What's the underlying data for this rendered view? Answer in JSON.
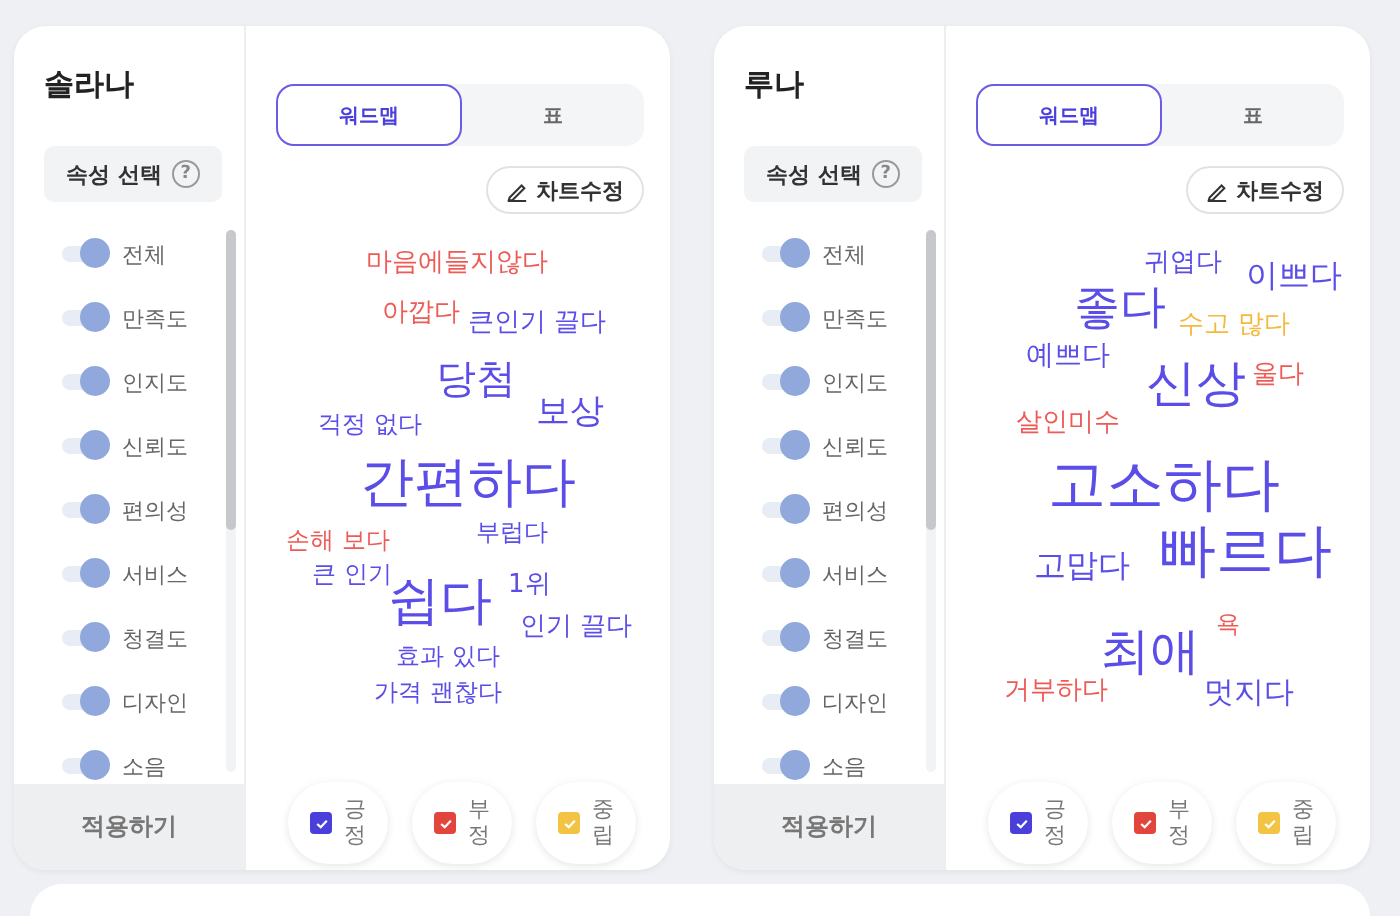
{
  "cards": [
    {
      "title": "솔라나",
      "attribute_header": {
        "label": "속성 선택",
        "help": "?"
      },
      "attributes": [
        {
          "label": "전체",
          "on": true
        },
        {
          "label": "만족도",
          "on": true
        },
        {
          "label": "인지도",
          "on": true
        },
        {
          "label": "신뢰도",
          "on": true
        },
        {
          "label": "편의성",
          "on": true
        },
        {
          "label": "서비스",
          "on": true
        },
        {
          "label": "청결도",
          "on": true
        },
        {
          "label": "디자인",
          "on": true
        },
        {
          "label": "소음",
          "on": true
        }
      ],
      "apply_button": "적용하기",
      "view_tabs": [
        {
          "label": "워드맵",
          "selected": true
        },
        {
          "label": "표",
          "selected": false
        }
      ],
      "edit_button": "차트수정",
      "words": [
        {
          "text": "마음에들지않다",
          "color": "#ee5b57"
        },
        {
          "text": "아깝다",
          "color": "#ee5b57"
        },
        {
          "text": "큰인기 끌다",
          "color": "#5b4ee8"
        },
        {
          "text": "당첨",
          "color": "#5b4ee8"
        },
        {
          "text": "보상",
          "color": "#5b4ee8"
        },
        {
          "text": "걱정 없다",
          "color": "#5b4ee8"
        },
        {
          "text": "간편하다",
          "color": "#5b4ee8"
        },
        {
          "text": "손해 보다",
          "color": "#ee5b57"
        },
        {
          "text": "부럽다",
          "color": "#5b4ee8"
        },
        {
          "text": "큰 인기",
          "color": "#5b4ee8"
        },
        {
          "text": "쉽다",
          "color": "#5b4ee8"
        },
        {
          "text": "1위",
          "color": "#5b4ee8"
        },
        {
          "text": "인기 끌다",
          "color": "#5b4ee8"
        },
        {
          "text": "효과 있다",
          "color": "#5b4ee8"
        },
        {
          "text": "가격 괜찮다",
          "color": "#5b4ee8"
        }
      ],
      "legend": [
        {
          "label": "긍정",
          "color": "#4b3fdc",
          "checked": true
        },
        {
          "label": "부정",
          "color": "#e2453c",
          "checked": true
        },
        {
          "label": "중립",
          "color": "#f3c444",
          "checked": true
        }
      ]
    },
    {
      "title": "루나",
      "attribute_header": {
        "label": "속성 선택",
        "help": "?"
      },
      "attributes": [
        {
          "label": "전체",
          "on": true
        },
        {
          "label": "만족도",
          "on": true
        },
        {
          "label": "인지도",
          "on": true
        },
        {
          "label": "신뢰도",
          "on": true
        },
        {
          "label": "편의성",
          "on": true
        },
        {
          "label": "서비스",
          "on": true
        },
        {
          "label": "청결도",
          "on": true
        },
        {
          "label": "디자인",
          "on": true
        },
        {
          "label": "소음",
          "on": true
        }
      ],
      "apply_button": "적용하기",
      "view_tabs": [
        {
          "label": "워드맵",
          "selected": true
        },
        {
          "label": "표",
          "selected": false
        }
      ],
      "edit_button": "차트수정",
      "words": [
        {
          "text": "귀엽다",
          "color": "#5b4ee8"
        },
        {
          "text": "이쁘다",
          "color": "#5b4ee8"
        },
        {
          "text": "좋다",
          "color": "#5b4ee8"
        },
        {
          "text": "수고 많다",
          "color": "#f6b93f"
        },
        {
          "text": "예쁘다",
          "color": "#5b4ee8"
        },
        {
          "text": "신상",
          "color": "#5b4ee8"
        },
        {
          "text": "울다",
          "color": "#ee5b57"
        },
        {
          "text": "살인미수",
          "color": "#ee5b57"
        },
        {
          "text": "고소하다",
          "color": "#5b4ee8"
        },
        {
          "text": "빠르다",
          "color": "#5b4ee8"
        },
        {
          "text": "고맙다",
          "color": "#5b4ee8"
        },
        {
          "text": "욕",
          "color": "#ee5b57"
        },
        {
          "text": "최애",
          "color": "#5b4ee8"
        },
        {
          "text": "거부하다",
          "color": "#ee5b57"
        },
        {
          "text": "멋지다",
          "color": "#5b4ee8"
        }
      ],
      "legend": [
        {
          "label": "긍정",
          "color": "#4b3fdc",
          "checked": true
        },
        {
          "label": "부정",
          "color": "#e2453c",
          "checked": true
        },
        {
          "label": "중립",
          "color": "#f3c444",
          "checked": true
        }
      ]
    }
  ]
}
